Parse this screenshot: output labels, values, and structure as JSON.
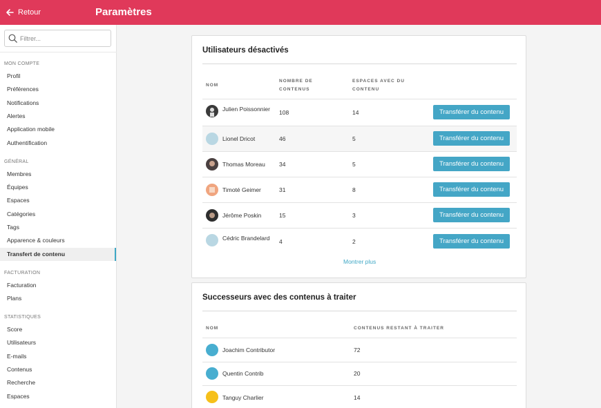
{
  "header": {
    "back_label": "Retour",
    "title": "Paramètres"
  },
  "sidebar": {
    "search_placeholder": "Filtrer...",
    "sections": [
      {
        "label": "MON COMPTE",
        "items": [
          "Profil",
          "Préférences",
          "Notifications",
          "Alertes",
          "Application mobile",
          "Authentification"
        ]
      },
      {
        "label": "GÉNÉRAL",
        "items": [
          "Membres",
          "Équipes",
          "Espaces",
          "Catégories",
          "Tags",
          "Apparence & couleurs",
          "Transfert de contenu"
        ]
      },
      {
        "label": "FACTURATION",
        "items": [
          "Facturation",
          "Plans"
        ]
      },
      {
        "label": "STATISTIQUES",
        "items": [
          "Score",
          "Utilisateurs",
          "E-mails",
          "Contenus",
          "Recherche",
          "Espaces"
        ]
      }
    ],
    "active_item": "Transfert de contenu"
  },
  "deactivated": {
    "title": "Utilisateurs désactivés",
    "columns": {
      "name": "NOM",
      "content_count": "NOMBRE DE CONTENUS",
      "spaces": "ESPACES AVEC DU CONTENU"
    },
    "rows": [
      {
        "name": "Julien Poissonnier",
        "content": "108",
        "spaces": "14",
        "avatar_color": "#3a3a3a"
      },
      {
        "name": "Lionel Dricot",
        "content": "46",
        "spaces": "5",
        "avatar_color": "#b9d7e3"
      },
      {
        "name": "Thomas Moreau",
        "content": "34",
        "spaces": "5",
        "avatar_color": "#4a4040"
      },
      {
        "name": "Timoté Geimer",
        "content": "31",
        "spaces": "8",
        "avatar_color": "#f0a57f"
      },
      {
        "name": "Jérôme Poskin",
        "content": "15",
        "spaces": "3",
        "avatar_color": "#2e2e2e"
      },
      {
        "name": "Cédric Brandelard",
        "content": "4",
        "spaces": "2",
        "avatar_color": "#b9d7e3"
      }
    ],
    "button_label": "Transférer du contenu",
    "show_more": "Montrer plus"
  },
  "successors": {
    "title": "Successeurs avec des contenus à traiter",
    "columns": {
      "name": "NOM",
      "remaining": "CONTENUS RESTANT À TRAITER"
    },
    "rows": [
      {
        "name": "Joachim Contributor",
        "remaining": "72",
        "avatar_color": "#48aed0"
      },
      {
        "name": "Quentin Contrib",
        "remaining": "20",
        "avatar_color": "#48aed0"
      },
      {
        "name": "Tanguy Charlier",
        "remaining": "14",
        "avatar_color": "#f6c01a"
      }
    ]
  },
  "colors": {
    "header_bg": "#e0395a",
    "accent": "#44a6c6"
  },
  "icons": {
    "back": "arrow-left-icon",
    "search": "search-icon"
  }
}
